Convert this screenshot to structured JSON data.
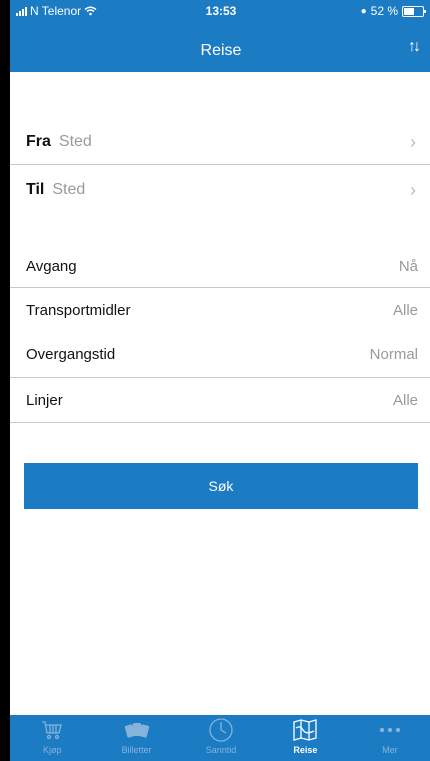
{
  "status_bar": {
    "carrier": "N Telenor",
    "time": "13:53",
    "battery": "52 %"
  },
  "nav": {
    "title": "Reise",
    "swap_icon": "swap-vertical-arrows"
  },
  "trip": {
    "from": {
      "label": "Fra",
      "placeholder": "Sted"
    },
    "to": {
      "label": "Til",
      "placeholder": "Sted"
    }
  },
  "options": {
    "departure": {
      "label": "Avgang",
      "value": "Nå"
    },
    "transport": {
      "label": "Transportmidler",
      "value": "Alle"
    },
    "transfer_time": {
      "label": "Overgangstid",
      "value": "Normal"
    },
    "lines": {
      "label": "Linjer",
      "value": "Alle"
    }
  },
  "search_button": "Søk",
  "tabs": [
    {
      "label": "Kjøp",
      "icon": "cart-icon",
      "active": false
    },
    {
      "label": "Billetter",
      "icon": "tickets-icon",
      "active": false
    },
    {
      "label": "Sanntid",
      "icon": "clock-icon",
      "active": false
    },
    {
      "label": "Reise",
      "icon": "map-icon",
      "active": true
    },
    {
      "label": "Mer",
      "icon": "more-icon",
      "active": false
    }
  ],
  "colors": {
    "primary": "#1b7cc4",
    "tab_inactive": "#86b3da",
    "placeholder": "#9a9a9a"
  }
}
